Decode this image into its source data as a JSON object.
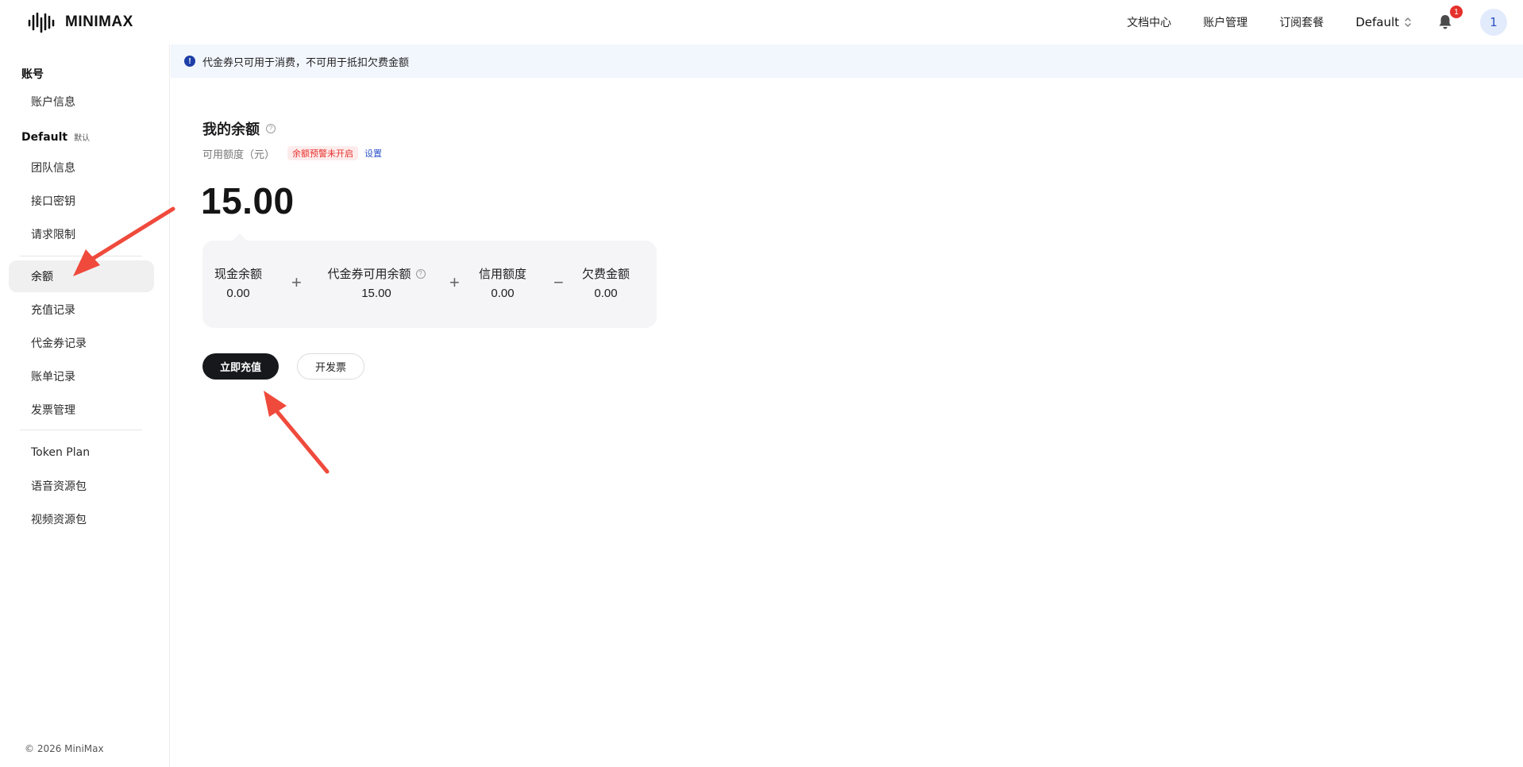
{
  "header": {
    "brand": "MINIMAX",
    "nav": [
      "文档中心",
      "账户管理",
      "订阅套餐"
    ],
    "team": "Default",
    "notification_count": "1",
    "avatar": "1"
  },
  "sidebar": {
    "account_group": "账号",
    "account_items": [
      "账户信息"
    ],
    "team_group": "Default",
    "team_tag": "默认",
    "team_items": [
      "团队信息",
      "接口密钥",
      "请求限制"
    ],
    "billing_items": [
      "余额",
      "充值记录",
      "代金券记录",
      "账单记录",
      "发票管理"
    ],
    "plan_items": [
      "Token Plan",
      "语音资源包",
      "视频资源包"
    ],
    "active": "余额",
    "copyright": "© 2026 MiniMax"
  },
  "notice": {
    "icon": "info-icon",
    "text": "代金券只可用于消费，不可用于抵扣欠费金额"
  },
  "balance": {
    "title": "我的余额",
    "subtitle": "可用额度（元）",
    "warning_tag": "余额预警未开启",
    "setting_link": "设置",
    "amount": "15.00",
    "breakdown": [
      {
        "label": "现金余额",
        "value": "0.00"
      },
      {
        "label": "代金券可用余额",
        "value": "15.00"
      },
      {
        "label": "信用额度",
        "value": "0.00"
      },
      {
        "label": "欠费金额",
        "value": "0.00"
      }
    ],
    "operators": [
      "+",
      "+",
      "−"
    ],
    "recharge_button": "立即充值",
    "invoice_button": "开发票"
  },
  "colors": {
    "accent": "#1e3fa8",
    "warning": "#e5302c",
    "annotation_arrow": "#ef4a3c",
    "primary_button": "#16181c"
  }
}
